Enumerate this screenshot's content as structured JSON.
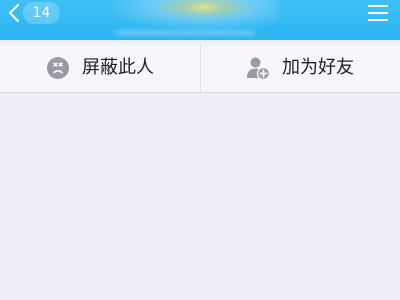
{
  "header": {
    "back_count": "14",
    "back_icon": "chevron-left-icon",
    "menu_icon": "hamburger-menu-icon",
    "bar_color": "#2bb4f2"
  },
  "actions": [
    {
      "label": "屏蔽此人",
      "icon": "block-user-icon",
      "icon_color": "#9a9aa6"
    },
    {
      "label": "加为好友",
      "icon": "add-friend-icon",
      "icon_color": "#9a9aa6"
    }
  ],
  "page_background": "#eeeff6"
}
